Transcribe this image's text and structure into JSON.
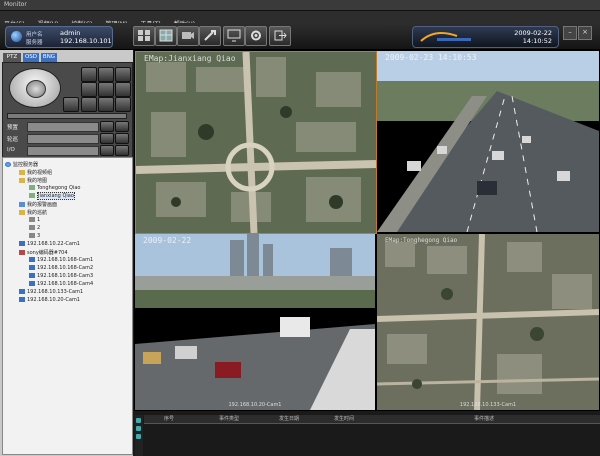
{
  "window": {
    "title": "Monitor"
  },
  "menu": [
    "平台(S)",
    "视频(V)",
    "控制(C)",
    "管理(M)",
    "工具(T)",
    "帮助(H)"
  ],
  "user": {
    "user_label": "用户名",
    "user_value": "admin",
    "server_label": "服务器",
    "server_value": "192.168.10.101"
  },
  "clock": {
    "date": "2009-02-22",
    "time": "14:10:52"
  },
  "toolbar_icons": [
    "grid-layout-icon",
    "map-icon",
    "record-icon",
    "tools-icon",
    "screen-icon",
    "config-icon",
    "exit-icon"
  ],
  "left": {
    "tabs": [
      "PTZ",
      "OSD",
      "BNG"
    ],
    "ptz_rows": [
      {
        "label": "预置"
      },
      {
        "label": "轮巡"
      },
      {
        "label": "I/O"
      }
    ],
    "tree": {
      "root": "监控服务器",
      "items": [
        "我的视频组",
        "我的地图",
        "Tonghegong Qiao",
        "Jianxiang Qiao",
        "我的报警画面",
        "我的巡航",
        "1",
        "2",
        "3",
        "192.168.10.22-Cam1",
        "sony编码器#704",
        "192.168.10.168-Cam1",
        "192.168.10.168-Cam2",
        "192.168.10.168-Cam3",
        "192.168.10.168-Cam4",
        "192.168.10.133-Cam1",
        "192.168.10.20-Cam1"
      ]
    }
  },
  "video": {
    "cells": [
      {
        "stamp": "EMap:Jianxiang Qiao",
        "caption": ""
      },
      {
        "stamp": "2009-02-23 14:10:53",
        "caption": ""
      },
      {
        "stamp": "2009-02-22",
        "caption": "192.168.10.20-Cam1"
      },
      {
        "stamp": "EMap:Tonghegong Qiao",
        "caption": "192.168.10.133-Cam1"
      }
    ]
  },
  "events": {
    "columns": [
      "序号",
      "事件类型",
      "发生日期",
      "发生时间",
      "事件描述"
    ]
  }
}
